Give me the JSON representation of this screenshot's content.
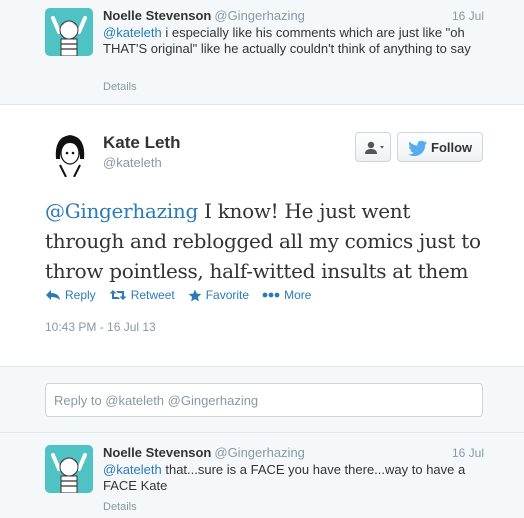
{
  "tweet_above": {
    "name": "Noelle Stevenson",
    "handle": "@Gingerhazing",
    "time": "16 Jul",
    "mention": "@kateleth",
    "text": " i especially like his comments which are just like \"oh THAT'S original\" like he actually couldn't think of anything to say",
    "details": "Details"
  },
  "main_tweet": {
    "name": "Kate Leth",
    "handle": "@kateleth",
    "follow_label": "Follow",
    "mention": "@Gingerhazing",
    "text": " I know! He just went through and reblogged all my comics just to throw pointless, half-witted insults at them",
    "actions": {
      "reply": "Reply",
      "retweet": "Retweet",
      "favorite": "Favorite",
      "more": "More"
    },
    "timestamp": "10:43 PM - 16 Jul 13"
  },
  "reply_box": {
    "placeholder": "Reply to @kateleth @Gingerhazing"
  },
  "tweet_below": {
    "name": "Noelle Stevenson",
    "handle": "@Gingerhazing",
    "time": "16 Jul",
    "mention": "@kateleth",
    "text": " that...sure is a FACE you have there...way to have a FACE Kate",
    "details": "Details"
  },
  "colors": {
    "link": "#2b7bb9",
    "avatar_bg": "#4fc3c3",
    "muted": "#8899a6",
    "twitter_bird": "#55acee"
  }
}
